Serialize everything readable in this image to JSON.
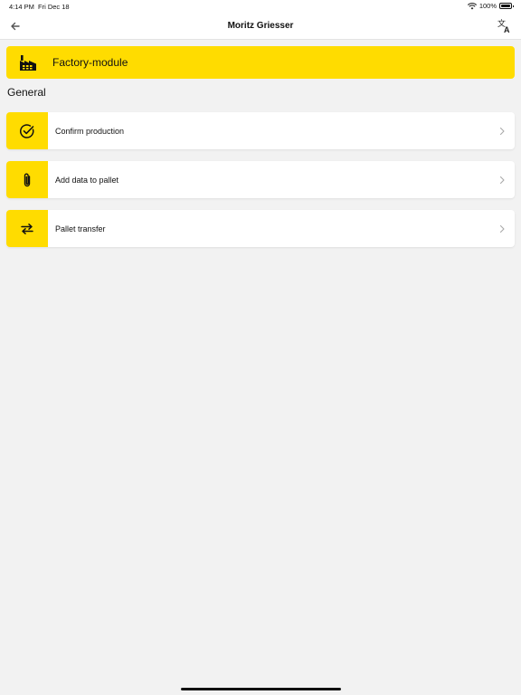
{
  "status_bar": {
    "time": "4:14 PM",
    "date": "Fri Dec 18",
    "battery": "100%",
    "wifi_icon": "wifi-icon",
    "battery_icon": "battery-icon"
  },
  "navbar": {
    "title": "Moritz Griesser",
    "back_icon": "arrow-left-icon",
    "translate_icon": "translate-icon"
  },
  "module": {
    "label": "Factory-module",
    "icon": "factory-icon"
  },
  "section": {
    "title": "General"
  },
  "menu": {
    "items": [
      {
        "label": "Confirm production",
        "icon": "check-circle-icon"
      },
      {
        "label": "Add data to pallet",
        "icon": "paperclip-icon"
      },
      {
        "label": "Pallet transfer",
        "icon": "swap-arrows-icon"
      }
    ]
  },
  "colors": {
    "accent": "#ffdc00",
    "background": "#f2f2f2",
    "card": "#ffffff"
  }
}
